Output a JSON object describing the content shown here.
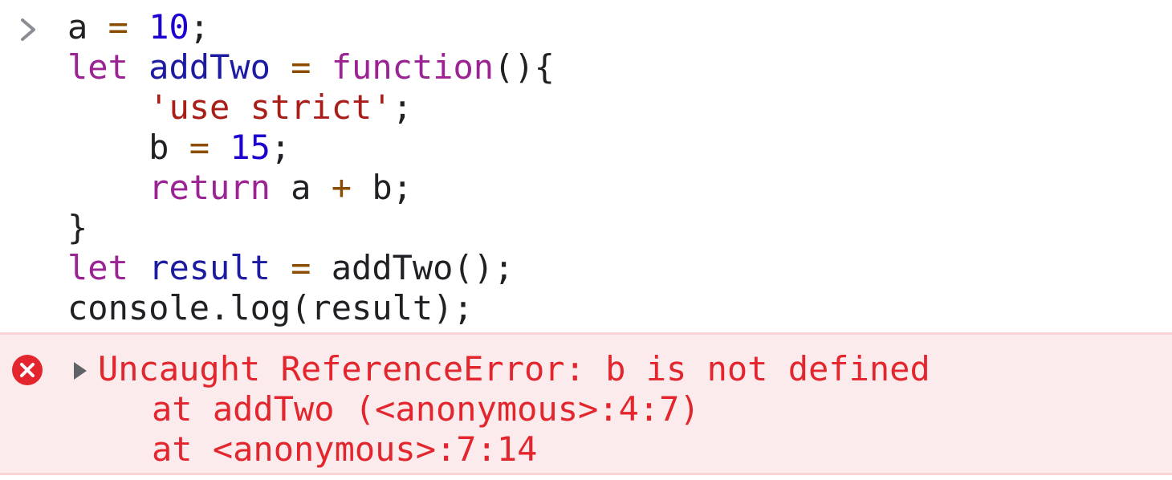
{
  "console": {
    "input": {
      "prompt_icon": "chevron-right-icon",
      "lines": [
        [
          {
            "t": "a",
            "c": "plain"
          },
          {
            "t": " ",
            "c": "plain"
          },
          {
            "t": "=",
            "c": "op"
          },
          {
            "t": " ",
            "c": "plain"
          },
          {
            "t": "10",
            "c": "num"
          },
          {
            "t": ";",
            "c": "plain"
          }
        ],
        [
          {
            "t": "let",
            "c": "kw"
          },
          {
            "t": " ",
            "c": "plain"
          },
          {
            "t": "addTwo",
            "c": "def"
          },
          {
            "t": " ",
            "c": "plain"
          },
          {
            "t": "=",
            "c": "op"
          },
          {
            "t": " ",
            "c": "plain"
          },
          {
            "t": "function",
            "c": "kw"
          },
          {
            "t": "(){",
            "c": "plain"
          }
        ],
        [
          {
            "t": "    ",
            "c": "plain"
          },
          {
            "t": "'use strict'",
            "c": "str"
          },
          {
            "t": ";",
            "c": "plain"
          }
        ],
        [
          {
            "t": "    b",
            "c": "plain"
          },
          {
            "t": " ",
            "c": "plain"
          },
          {
            "t": "=",
            "c": "op"
          },
          {
            "t": " ",
            "c": "plain"
          },
          {
            "t": "15",
            "c": "num"
          },
          {
            "t": ";",
            "c": "plain"
          }
        ],
        [
          {
            "t": "    ",
            "c": "plain"
          },
          {
            "t": "return",
            "c": "kw"
          },
          {
            "t": " a ",
            "c": "plain"
          },
          {
            "t": "+",
            "c": "op"
          },
          {
            "t": " b;",
            "c": "plain"
          }
        ],
        [
          {
            "t": "}",
            "c": "plain"
          }
        ],
        [
          {
            "t": "let",
            "c": "kw"
          },
          {
            "t": " ",
            "c": "plain"
          },
          {
            "t": "result",
            "c": "def"
          },
          {
            "t": " ",
            "c": "plain"
          },
          {
            "t": "=",
            "c": "op"
          },
          {
            "t": " addTwo();",
            "c": "plain"
          }
        ],
        [
          {
            "t": "console.log(result);",
            "c": "plain"
          }
        ]
      ]
    },
    "error": {
      "icon": "error-circle-icon",
      "expand_icon": "expand-triangle-icon",
      "message": "Uncaught ReferenceError: b is not defined",
      "stack": [
        "at addTwo (<anonymous>:4:7)",
        "at <anonymous>:7:14"
      ],
      "colors": {
        "text": "#e3262d",
        "background": "#fcebec",
        "border": "#f9d3d5"
      }
    }
  }
}
